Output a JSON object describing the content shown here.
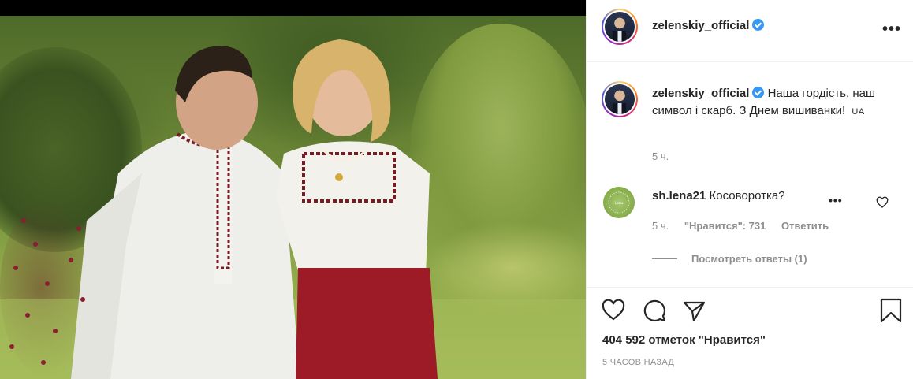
{
  "post": {
    "username": "zelenskiy_official",
    "caption": "Наша гордість, наш символ і скарб. З Днем вишиванки!",
    "caption_flag": "UA",
    "time_ago": "5 ч."
  },
  "comment": {
    "username": "sh.lena21",
    "text": "Косоворотка?",
    "time": "5 ч.",
    "likes": "\"Нравится\": 731",
    "reply": "Ответить",
    "view_replies": "Посмотреть ответы (1)"
  },
  "footer": {
    "likes_count": "404 592 отметок \"Нравится\"",
    "posted": "5 ЧАСОВ НАЗАД"
  },
  "icons": {
    "verified": "verified-badge-icon",
    "more": "more-options-icon",
    "like": "heart-icon",
    "comment": "comment-icon",
    "share": "share-icon",
    "save": "bookmark-icon"
  },
  "colors": {
    "verified": "#3897f0",
    "secondary_text": "#8e8e8e",
    "primary_text": "#262626"
  }
}
